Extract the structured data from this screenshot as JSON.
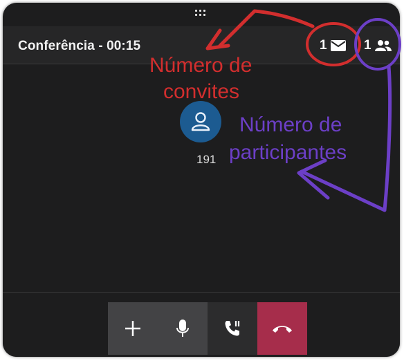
{
  "header": {
    "title": "Conferência - 00:15",
    "invites_count": "1",
    "participants_count": "1"
  },
  "participant": {
    "label": "191"
  },
  "annotations": {
    "invites_line1": "Número de",
    "invites_line2": "convites",
    "participants_line1": "Número de",
    "participants_line2": "participantes"
  },
  "icons": [
    "drag-handle-icon",
    "envelope-icon",
    "users-icon",
    "user-icon",
    "plus-icon",
    "microphone-icon",
    "phone-transfer-icon",
    "hangup-icon"
  ],
  "colors": {
    "window_bg": "#1d1d1e",
    "header_bg": "#262627",
    "avatar_bg": "#1c5b91",
    "hangup_bg": "#a62d4b",
    "annotation_red": "#d22e2e",
    "annotation_purple": "#6c3fc7"
  }
}
